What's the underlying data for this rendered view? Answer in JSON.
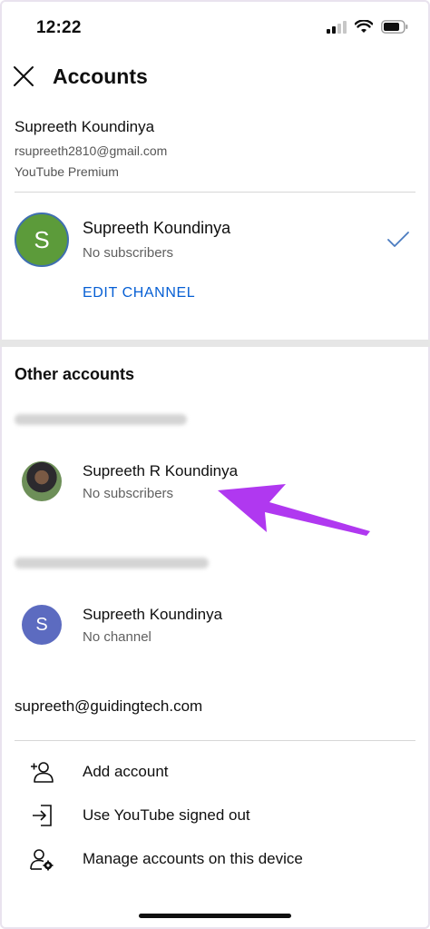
{
  "status_bar": {
    "time": "12:22"
  },
  "header": {
    "title": "Accounts"
  },
  "current_account": {
    "name": "Supreeth Koundinya",
    "email": "rsupreeth2810@gmail.com",
    "tier": "YouTube Premium",
    "channel": {
      "avatar_letter": "S",
      "name": "Supreeth Koundinya",
      "subtitle": "No subscribers",
      "edit_label": "EDIT CHANNEL"
    }
  },
  "other_accounts": {
    "title": "Other accounts",
    "groups": [
      {
        "channel_name": "Supreeth R Koundinya",
        "subtitle": "No subscribers",
        "avatar": "profile-photo"
      },
      {
        "channel_name": "Supreeth Koundinya",
        "subtitle": "No channel",
        "avatar_letter": "S"
      }
    ],
    "visible_email": "supreeth@guidingtech.com"
  },
  "menu": [
    {
      "label": "Add account",
      "icon": "add-person-icon"
    },
    {
      "label": "Use YouTube signed out",
      "icon": "sign-out-icon"
    },
    {
      "label": "Manage accounts on this device",
      "icon": "manage-accounts-icon"
    }
  ],
  "colors": {
    "accent_blue": "#065fd4",
    "annotation_arrow": "#b038f0",
    "green_avatar": "#5c9b3a",
    "blue_avatar": "#5c6bc0"
  }
}
